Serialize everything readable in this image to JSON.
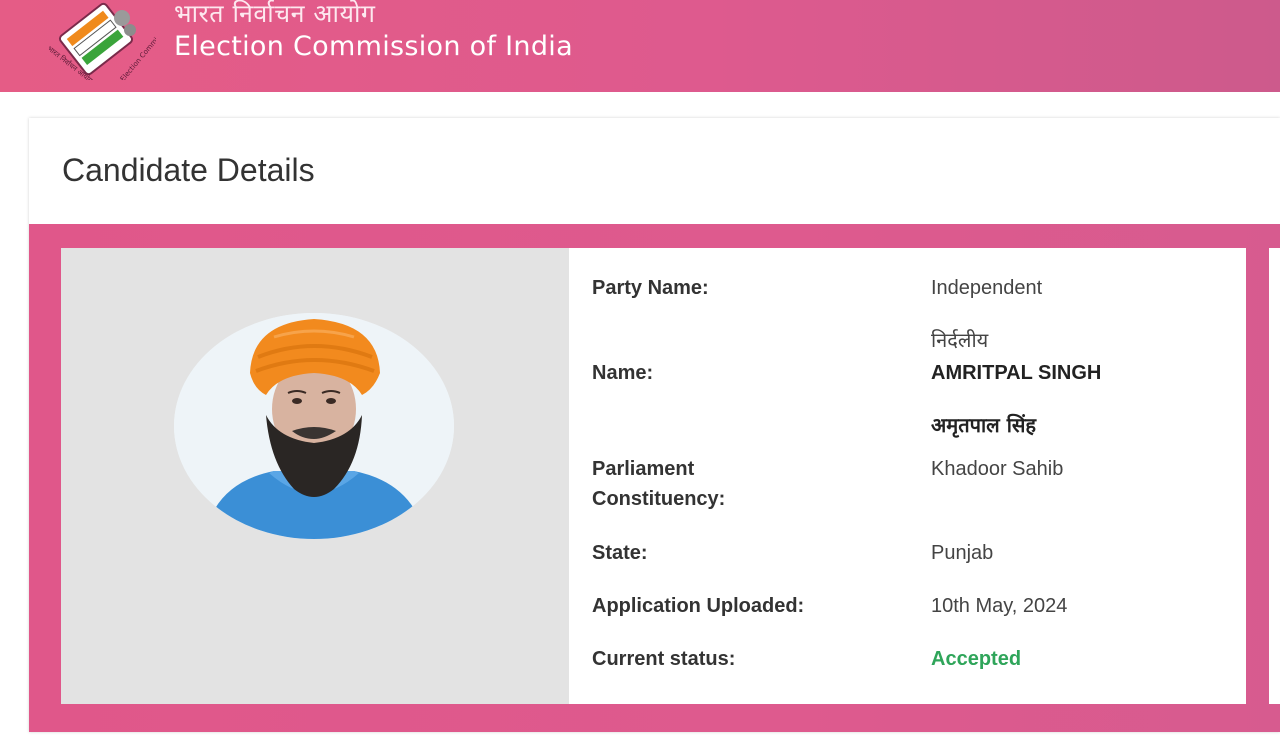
{
  "header": {
    "title_hindi": "भारत निर्वाचन आयोग",
    "title_english": "Election Commission of India",
    "logo_icon": "eci-ballot-logo-icon"
  },
  "card": {
    "title": "Candidate Details"
  },
  "candidate": {
    "photo_icon": "candidate-photo",
    "party_label": "Party Name:",
    "party_value": "Independent",
    "party_value_hindi": "निर्दलीय",
    "name_label": "Name:",
    "name_value": "AMRITPAL SINGH",
    "name_value_hindi": "अमृतपाल सिंह",
    "constituency_label_line1": "Parliament",
    "constituency_label_line2": "Constituency:",
    "constituency_value": "Khadoor Sahib",
    "state_label": "State:",
    "state_value": "Punjab",
    "uploaded_label": "Application Uploaded:",
    "uploaded_value": "10th May, 2024",
    "status_label": "Current status:",
    "status_value": "Accepted"
  },
  "colors": {
    "brand_pink": "#de5a8e",
    "accepted_green": "#2fa55a"
  }
}
